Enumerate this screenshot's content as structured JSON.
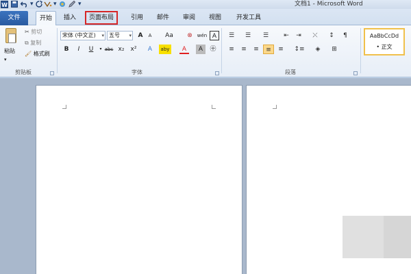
{
  "window": {
    "title": "文档1 - Microsoft Word",
    "app_icon_label": "W"
  },
  "qat": {
    "save_icon": "save-icon",
    "undo_icon": "undo-icon",
    "redo_icon": "redo-icon",
    "separator": "|",
    "more": "▾"
  },
  "tabs": {
    "file": "文件",
    "home": "开始",
    "insert": "插入",
    "page_layout": "页面布局",
    "references": "引用",
    "mailings": "邮件",
    "review": "审阅",
    "view": "视图",
    "developer": "开发工具"
  },
  "ribbon": {
    "clipboard": {
      "label": "剪贴板",
      "paste": "粘贴",
      "cut": "剪切",
      "copy": "复制",
      "format_painter": "格式刷"
    },
    "font": {
      "label": "字体",
      "font_name": "宋体 (中文正)",
      "font_size": "五号",
      "grow": "A",
      "shrink": "A",
      "change_case": "Aa",
      "clear_format": "⊗",
      "phonetic": "wén",
      "char_border": "A",
      "bold": "B",
      "italic": "I",
      "underline": "U",
      "strikethrough": "abc",
      "subscript": "x₂",
      "superscript": "x²",
      "text_effect": "A",
      "highlight": "aby",
      "font_color": "A",
      "char_shading": "A",
      "enclose_char": "㊉"
    },
    "paragraph": {
      "label": "段落",
      "bullets": "☰",
      "numbering": "☰",
      "multilevel": "☰",
      "decrease_indent": "⇤",
      "increase_indent": "⇥",
      "chinese_layout": "⤬",
      "sort": "↕",
      "show_marks": "¶",
      "align_left": "≡",
      "align_center": "≡",
      "align_right": "≡",
      "justify": "≡",
      "distributed": "≡",
      "line_spacing": "↕≡",
      "shading": "◈",
      "borders": "⊞"
    },
    "styles": {
      "sample": "AaBbCcDd",
      "name": "• 正文"
    }
  },
  "colors": {
    "accent": "#2a5aa0",
    "highlight_border": "#d62626",
    "justify_active": "#fbd88a",
    "font_color": "#e02020",
    "highlight_color": "#f8e000"
  }
}
